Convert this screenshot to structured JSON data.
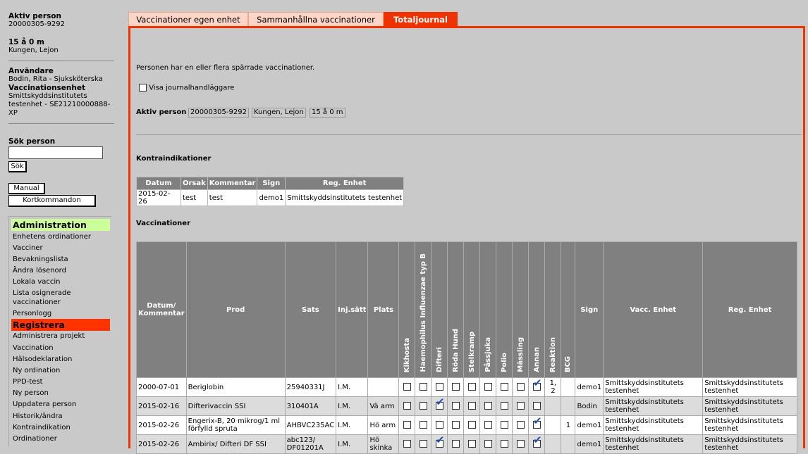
{
  "sidebar": {
    "active_person_heading": "Aktiv person",
    "person_id": "20000305-9292",
    "age": "15 å 0 m",
    "person_name": "Kungen, Lejon",
    "user_heading": "Användare",
    "user_name": "Bodin, Rita - Sjuksköterska",
    "unit_heading": "Vaccinationsenhet",
    "unit_line1": "Smittskyddsinstitutets",
    "unit_line2": "testenhet - SE21210000888-",
    "unit_line3": "XP",
    "search_heading": "Sök person",
    "search_value": "",
    "search_button": "Sök",
    "manual_button": "Manual",
    "shortcuts_button": "Kortkommandon",
    "admin_heading": "Administration",
    "admin_items": [
      "Enhetens ordinationer",
      "Vacciner",
      "Bevakningslista",
      "Ändra lösenord",
      "Lokala vaccin",
      "Lista osignerade",
      "vaccinationer",
      "Personlogg"
    ],
    "register_heading": "Registrera",
    "register_items": [
      "Administrera projekt",
      "Vaccination",
      "Hälsodeklaration",
      "Ny ordination",
      "PPD-test",
      "Ny person",
      "Uppdatera person",
      "Historik/ändra",
      "Kontraindikation",
      "Ordinationer"
    ]
  },
  "tabs": [
    "Vaccinationer egen enhet",
    "Sammanhållna vaccinationer",
    "Totaljournal"
  ],
  "main": {
    "notice": "Personen har en eller flera spärrade vaccinationer.",
    "show_journal_label": "Visa journalhandläggare",
    "active_person_label": "Aktiv person",
    "active_person_id": "20000305-9292",
    "active_person_name": "Kungen, Lejon",
    "active_person_age": "15 å 0 m",
    "contra_heading": "Kontraindikationer",
    "contra_headers": [
      "Datum",
      "Orsak",
      "Kommentar",
      "Sign",
      "Reg. Enhet"
    ],
    "contra_rows": [
      [
        "2015-02-26",
        "test",
        "test",
        "demo1",
        "Smittskyddsinstitutets testenhet"
      ]
    ],
    "vacc_heading": "Vaccinationer",
    "vacc_headers": {
      "date": "Datum/ Kommentar",
      "prod": "Prod",
      "sats": "Sats",
      "inj": "Inj.sätt",
      "plats": "Plats",
      "diseases": [
        "Kikhosta",
        "Haemophilus Influenzae typ B",
        "Difteri",
        "Röda Hund",
        "Stelkramp",
        "Påssjuka",
        "Polio",
        "Mässling",
        "Annan",
        "Reaktion",
        "BCG"
      ],
      "sign": "Sign",
      "vacc_unit": "Vacc. Enhet",
      "reg_unit": "Reg. Enhet"
    },
    "vacc_rows": [
      {
        "date": "2000-07-01",
        "prod": "Beriglobin",
        "sats": "25940331J",
        "inj": "I.M.",
        "plats": "",
        "checks": [
          false,
          false,
          false,
          false,
          false,
          false,
          false,
          false,
          true
        ],
        "reaktion": "1, 2",
        "bcg": "",
        "sign": "demo1",
        "vacc_unit": "Smittskyddsinstitutets testenhet",
        "reg_unit": "Smittskyddsinstitutets testenhet"
      },
      {
        "date": "2015-02-16",
        "prod": "Difterivaccin SSI",
        "sats": "310401A",
        "inj": "I.M.",
        "plats": "Vä arm",
        "checks": [
          false,
          false,
          true,
          false,
          false,
          false,
          false,
          false,
          false
        ],
        "reaktion": "",
        "bcg": "",
        "sign": "Bodin",
        "vacc_unit": "Smittskyddsinstitutets testenhet",
        "reg_unit": "Smittskyddsinstitutets testenhet"
      },
      {
        "date": "2015-02-26",
        "prod": "Engerix-B, 20 mikrog/1 ml förfylld spruta",
        "sats": "AHBVC235AC",
        "inj": "I.M.",
        "plats": "Hö arm",
        "checks": [
          false,
          false,
          false,
          false,
          false,
          false,
          false,
          false,
          true
        ],
        "reaktion": "",
        "bcg": "1",
        "sign": "demo1",
        "vacc_unit": "Smittskyddsinstitutets testenhet",
        "reg_unit": "Smittskyddsinstitutets testenhet"
      },
      {
        "date": "2015-02-26",
        "prod": "Ambirix/ Difteri DF SSI",
        "sats": "abc123/ DF01201A",
        "inj": "I.M.",
        "plats": "Hö skinka",
        "checks": [
          false,
          false,
          true,
          false,
          false,
          false,
          false,
          false,
          true
        ],
        "reaktion": "",
        "bcg": "",
        "sign": "demo1",
        "vacc_unit": "Smittskyddsinstitutets testenhet",
        "reg_unit": "Smittskyddsinstitutets testenhet"
      }
    ]
  }
}
